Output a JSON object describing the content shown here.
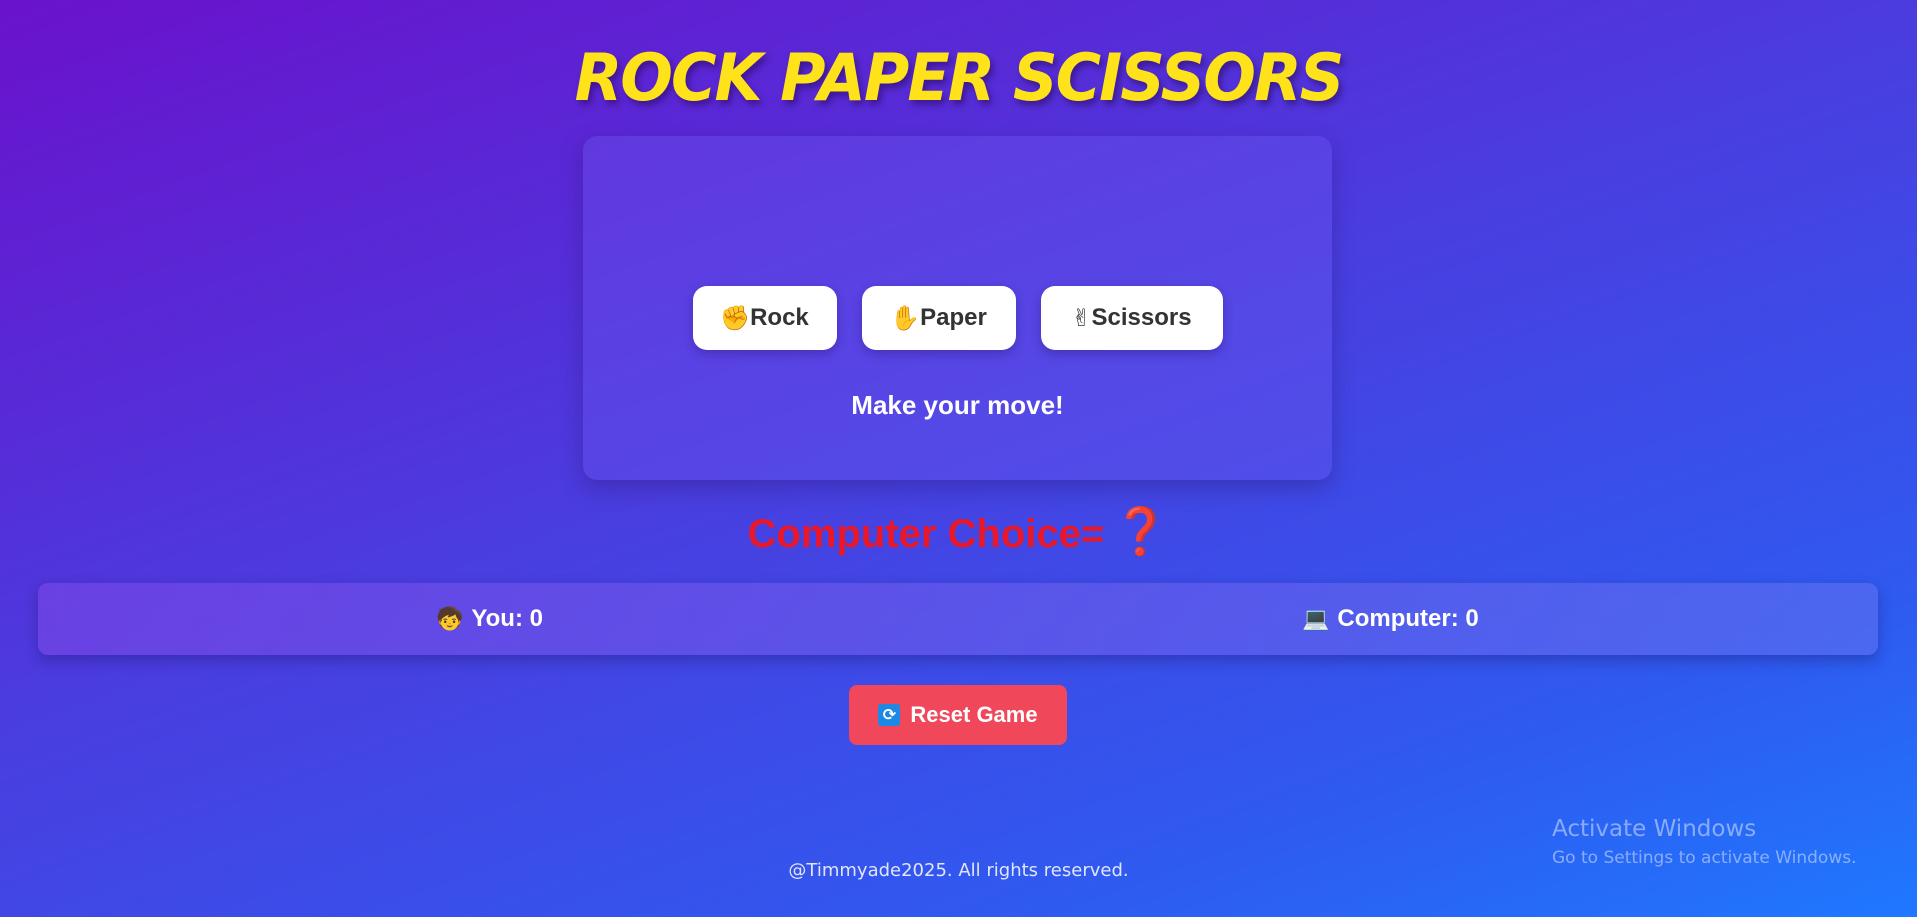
{
  "title": "Rock Paper Scissors",
  "choices": {
    "rock": {
      "icon": "✊",
      "label": "Rock"
    },
    "paper": {
      "icon": "✋",
      "label": "Paper"
    },
    "scissors": {
      "icon": "✌",
      "label": "Scissors"
    }
  },
  "status_message": "Make your move!",
  "computer_choice": {
    "label": "Computer Choice=",
    "value": "❓"
  },
  "scoreboard": {
    "you": {
      "icon": "🧒",
      "label": "You: 0"
    },
    "computer": {
      "icon": "💻",
      "label": "Computer: 0"
    }
  },
  "reset": {
    "icon": "🔄",
    "label": "Reset Game"
  },
  "footer": "@Timmyade2025. All rights reserved.",
  "watermark": {
    "line1": "Activate Windows",
    "line2": "Go to Settings to activate Windows."
  },
  "colors": {
    "title": "#ffe31a",
    "computer_choice": "#e8182a",
    "reset_button": "#f0475a"
  }
}
